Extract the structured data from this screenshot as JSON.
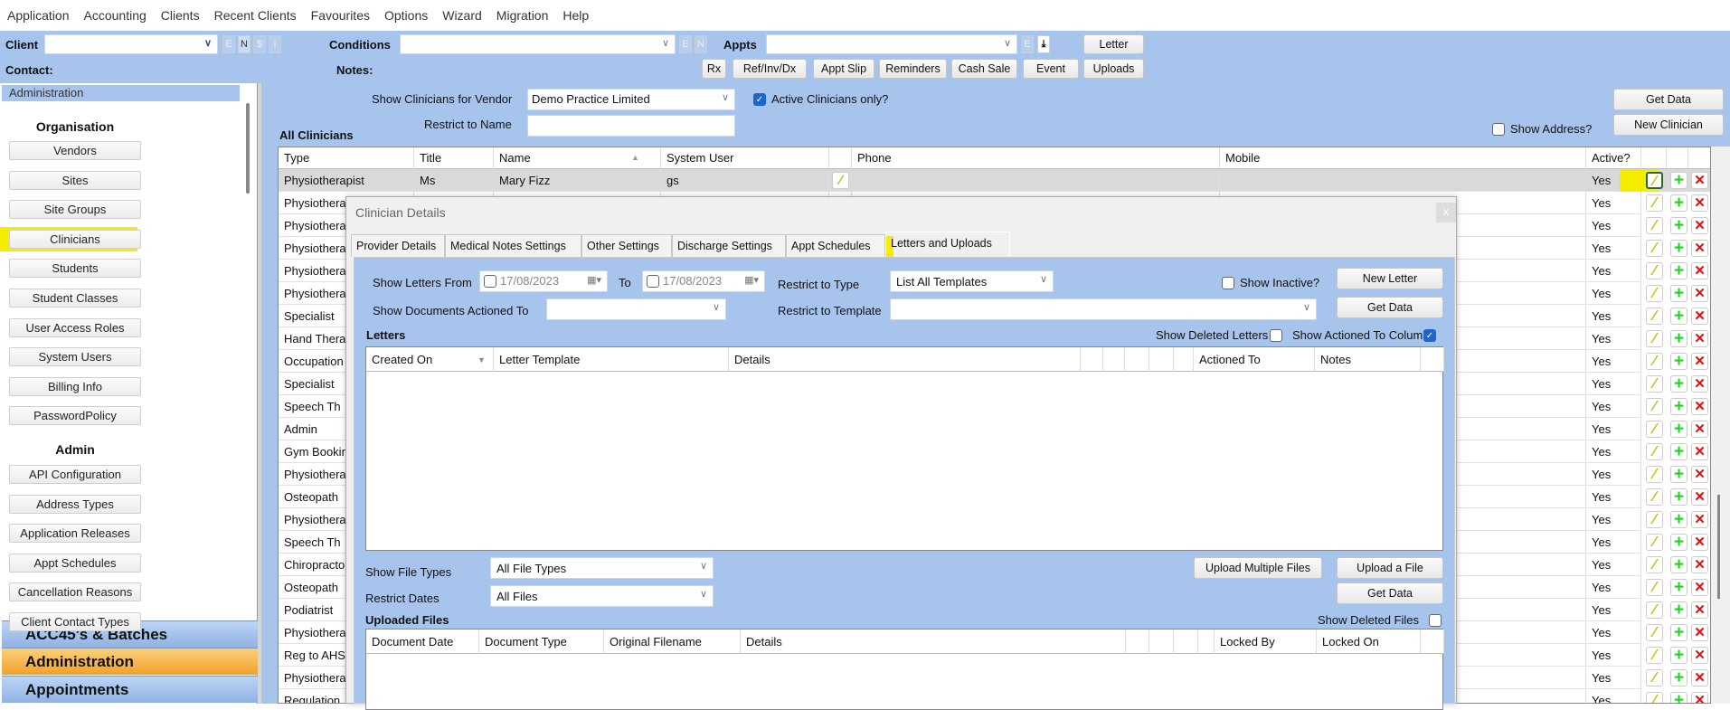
{
  "menu": [
    "Application",
    "Accounting",
    "Clients",
    "Recent Clients",
    "Favourites",
    "Options",
    "Wizard",
    "Migration",
    "Help"
  ],
  "toolbar": {
    "client_label": "Client",
    "client_value": "",
    "client_minis": [
      "E",
      "N",
      "$",
      "i"
    ],
    "conditions_label": "Conditions",
    "conditions_value": "",
    "conditions_minis": [
      "E",
      "N"
    ],
    "appts_label": "Appts",
    "appts_value": "",
    "appts_mini": "E",
    "download_icon": "download-icon",
    "letter": "Letter",
    "contact_label": "Contact:",
    "notes_label": "Notes:",
    "buttons": [
      "Rx",
      "Ref/Inv/Dx",
      "Appt Slip",
      "Reminders",
      "Cash Sale",
      "Event",
      "Uploads"
    ]
  },
  "sidebar": {
    "header": "Administration",
    "org_heading": "Organisation",
    "org_items": [
      "Vendors",
      "Sites",
      "Site Groups",
      "Clinicians",
      "Students",
      "Student Classes",
      "User Access Roles",
      "System Users",
      "Billing Info",
      "PasswordPolicy"
    ],
    "admin_heading": "Admin",
    "admin_items": [
      "API Configuration",
      "Address Types",
      "Application Releases",
      "Appt Schedules",
      "Cancellation Reasons",
      "Client Contact Types"
    ],
    "nav": [
      "ACC45's & Batches",
      "Administration",
      "Appointments"
    ],
    "highlight_color": "#f5ec00"
  },
  "main": {
    "vendor_label": "Show Clinicians for Vendor",
    "vendor_value": "Demo Practice Limited",
    "active_only_label": "Active Clinicians only?",
    "active_only_checked": true,
    "restrict_name_label": "Restrict to Name",
    "restrict_name_value": "",
    "show_address_label": "Show Address?",
    "show_address_checked": false,
    "get_data": "Get Data",
    "new_clinician": "New Clinician",
    "grid_title": "All Clinicians",
    "columns": [
      "Type",
      "Title",
      "Name",
      "System User",
      "",
      "Phone",
      "Mobile",
      "Active?"
    ],
    "rows": [
      {
        "type": "Physiotherapist",
        "title": "Ms",
        "name": "Mary Fizz",
        "user": "gs",
        "active": "Yes"
      },
      {
        "type": "Physiothera",
        "active": "Yes"
      },
      {
        "type": "Physiothera",
        "active": "Yes"
      },
      {
        "type": "Physiothera",
        "active": "Yes"
      },
      {
        "type": "Physiothera",
        "active": "Yes"
      },
      {
        "type": "Physiothera",
        "active": "Yes"
      },
      {
        "type": "Specialist",
        "active": "Yes"
      },
      {
        "type": "Hand Thera",
        "active": "Yes"
      },
      {
        "type": "Occupation",
        "active": "Yes"
      },
      {
        "type": "Specialist",
        "active": "Yes"
      },
      {
        "type": "Speech Th",
        "active": "Yes"
      },
      {
        "type": "Admin",
        "active": "Yes"
      },
      {
        "type": "Gym Bookin",
        "active": "Yes"
      },
      {
        "type": "Physiothera",
        "active": "Yes"
      },
      {
        "type": "Osteopath",
        "active": "Yes"
      },
      {
        "type": "Physiothera",
        "active": "Yes"
      },
      {
        "type": "Speech Th",
        "active": "Yes"
      },
      {
        "type": "Chiropracto",
        "active": "Yes"
      },
      {
        "type": "Osteopath",
        "active": "Yes"
      },
      {
        "type": "Podiatrist",
        "active": "Yes"
      },
      {
        "type": "Physiothera",
        "active": "Yes"
      },
      {
        "type": "Reg to AHS",
        "active": "Yes"
      },
      {
        "type": "Physiothera",
        "active": "Yes"
      },
      {
        "type": "Regulation",
        "active": "Yes"
      }
    ]
  },
  "dialog": {
    "title": "Clinician Details",
    "close": "x",
    "tabs": [
      "Provider Details",
      "Medical Notes Settings",
      "Other Settings",
      "Discharge Settings",
      "Appt Schedules",
      "Letters and Uploads"
    ],
    "active_tab": "Letters and Uploads",
    "show_letters_from_label": "Show Letters From",
    "from_date": "17/08/2023",
    "to_label": "To",
    "to_date": "17/08/2023",
    "restrict_type_label": "Restrict to Type",
    "restrict_type_value": "List All Templates",
    "show_inactive_label": "Show Inactive?",
    "new_letter": "New Letter",
    "actioned_to_label": "Show Documents Actioned To",
    "restrict_template_label": "Restrict to Template",
    "get_data": "Get Data",
    "letters_title": "Letters",
    "show_deleted_letters_label": "Show Deleted Letters",
    "show_actioned_cols_label": "Show Actioned To Columns",
    "show_actioned_cols_checked": true,
    "letters_columns": [
      "Created On",
      "Letter Template",
      "Details",
      "",
      "",
      "",
      "",
      "",
      "Actioned To",
      "Notes",
      ""
    ],
    "file_types_label": "Show File Types",
    "file_types_value": "All File Types",
    "restrict_dates_label": "Restrict Dates",
    "restrict_dates_value": "All Files",
    "upload_multiple": "Upload Multiple Files",
    "upload_file": "Upload a File",
    "get_data_files": "Get Data",
    "uploaded_title": "Uploaded Files",
    "show_deleted_files_label": "Show Deleted Files",
    "files_columns": [
      "Document Date",
      "Document Type",
      "Original Filename",
      "Details",
      "",
      "",
      "",
      "",
      "Locked By",
      "Locked On",
      ""
    ]
  }
}
